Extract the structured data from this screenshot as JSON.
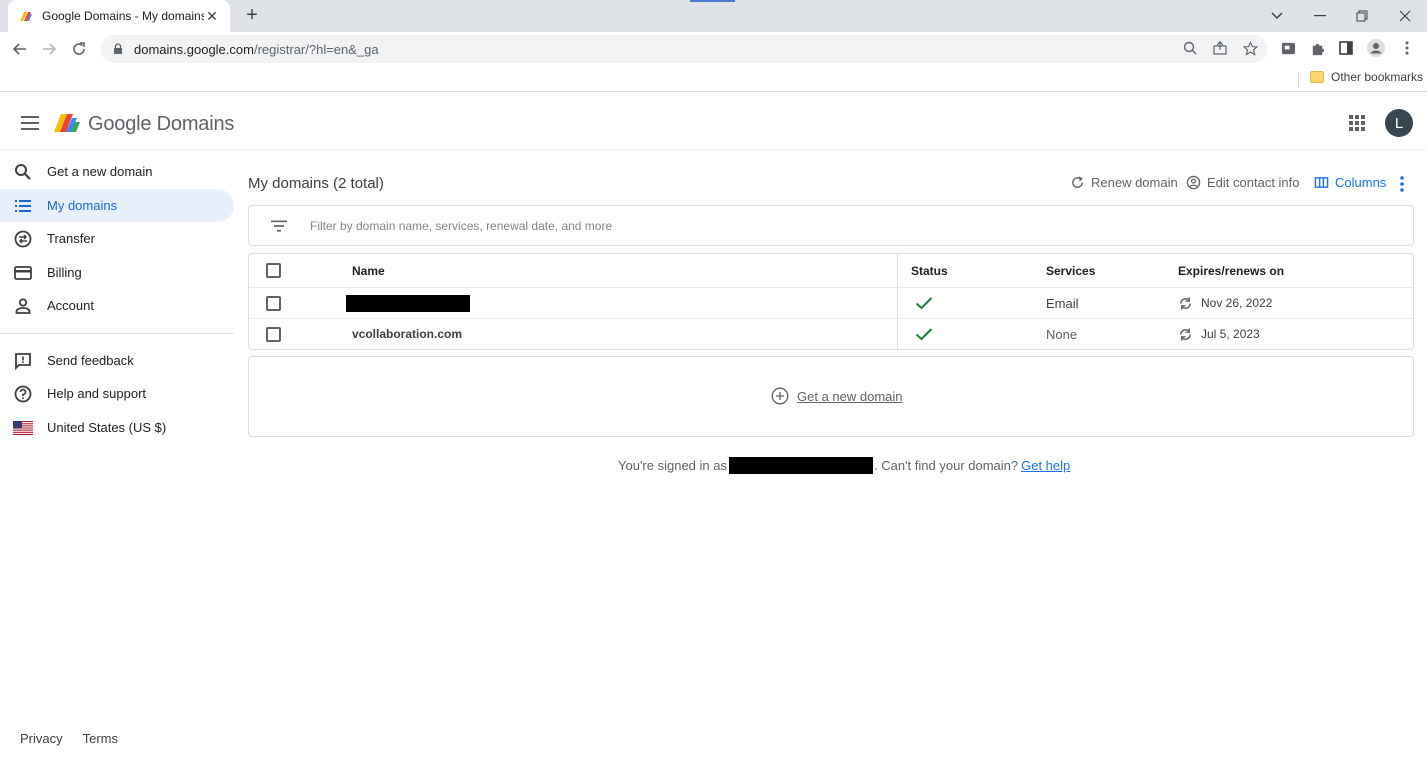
{
  "browser": {
    "tab_title": "Google Domains - My domains",
    "url_host": "domains.google.com",
    "url_path": "/registrar/?hl=en&_ga",
    "other_bookmarks": "Other bookmarks"
  },
  "header": {
    "product_name": "Google Domains",
    "avatar_initial": "L"
  },
  "sidebar": {
    "items": [
      {
        "label": "Get a new domain",
        "icon": "search-icon"
      },
      {
        "label": "My domains",
        "icon": "list-icon",
        "active": true
      },
      {
        "label": "Transfer",
        "icon": "transfer-icon"
      },
      {
        "label": "Billing",
        "icon": "credit-card-icon"
      },
      {
        "label": "Account",
        "icon": "person-icon"
      }
    ],
    "secondary": [
      {
        "label": "Send feedback",
        "icon": "feedback-icon"
      },
      {
        "label": "Help and support",
        "icon": "help-icon"
      },
      {
        "label": "United States (US $)",
        "icon": "us-flag-icon"
      }
    ]
  },
  "main": {
    "title": "My domains (2 total)",
    "actions": {
      "renew": "Renew domain",
      "edit_contact": "Edit contact info",
      "columns": "Columns"
    },
    "filter_placeholder": "Filter by domain name, services, renewal date, and more",
    "table": {
      "headers": {
        "name": "Name",
        "status": "Status",
        "services": "Services",
        "expires": "Expires/renews on"
      },
      "rows": [
        {
          "name": "",
          "redacted": true,
          "status": "active",
          "services": "Email",
          "expires": "Nov 26, 2022"
        },
        {
          "name": "vcollaboration.com",
          "redacted": false,
          "status": "active",
          "services": "None",
          "expires": "Jul 5, 2023"
        }
      ]
    },
    "add_domain": "Get a new domain",
    "signed_in_prefix": "You're signed in as",
    "signed_in_suffix": ". Can't find your domain?",
    "get_help": "Get help"
  },
  "footer": {
    "privacy": "Privacy",
    "terms": "Terms"
  },
  "colors": {
    "accent": "#1a73e8",
    "active_bg": "#e8f0fe",
    "check_green": "#188038"
  }
}
